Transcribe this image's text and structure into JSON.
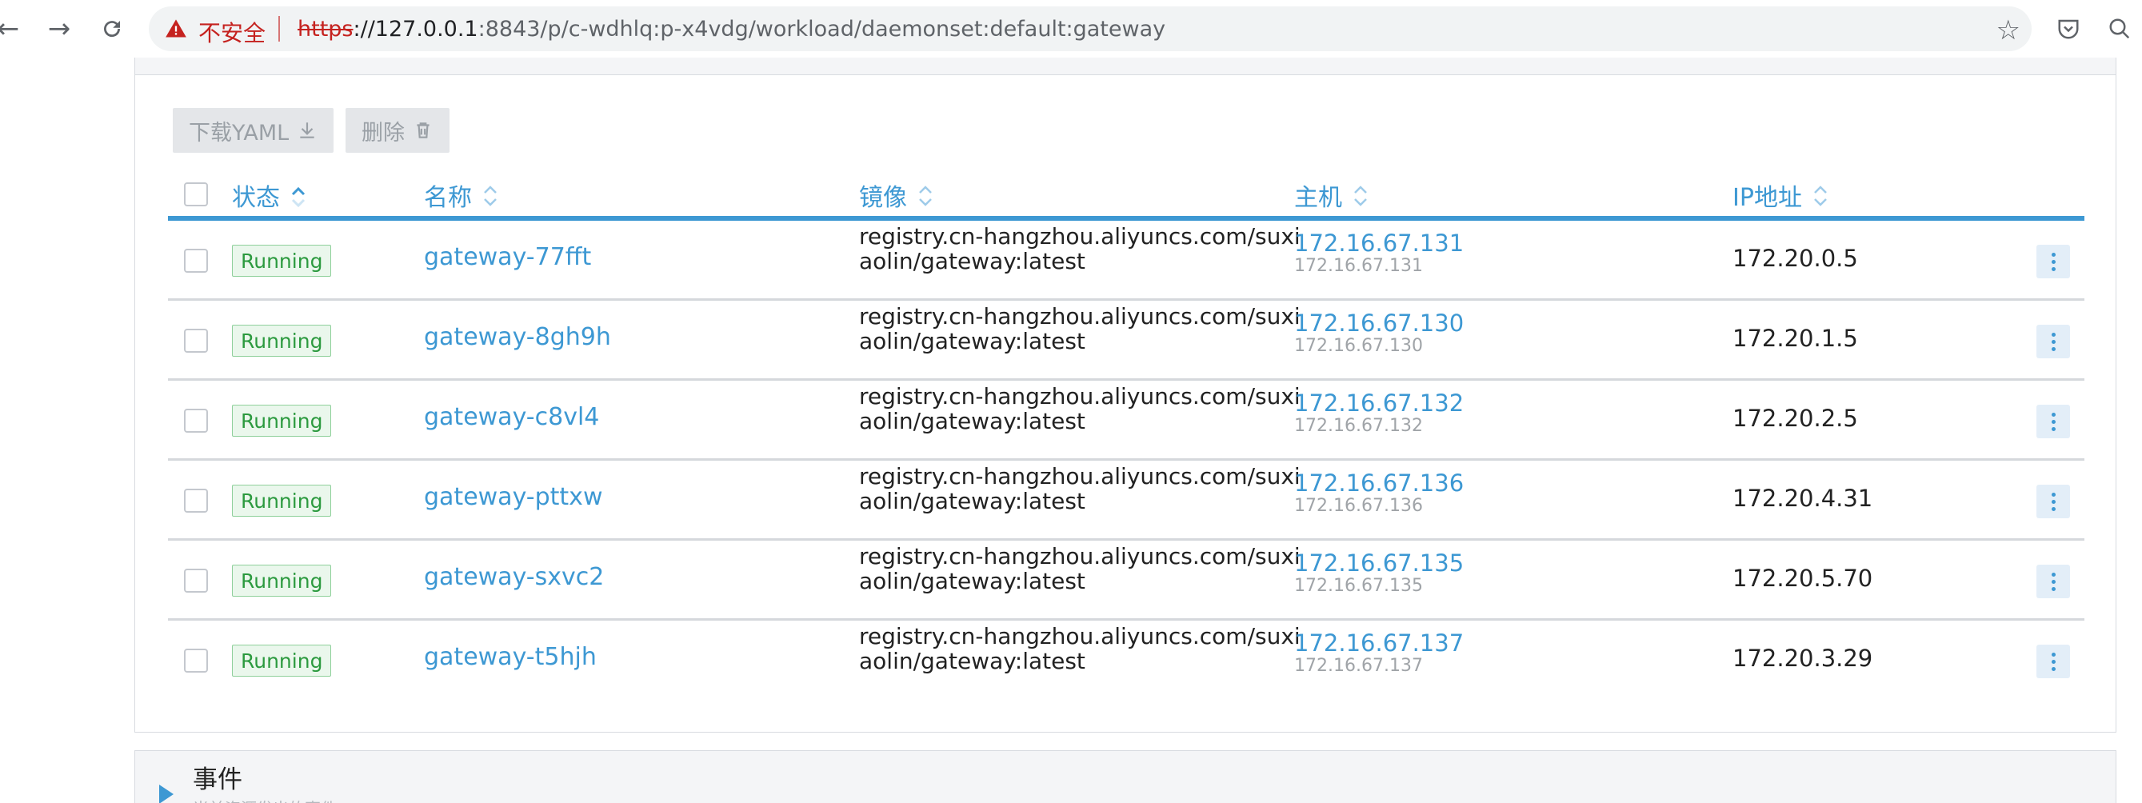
{
  "browser": {
    "insecure_label": "不安全",
    "url_scheme": "https",
    "url_host": "://127.0.0.1",
    "url_rest": ":8843/p/c-wdhlq:p-x4vdg/workload/daemonset:default:gateway"
  },
  "toolbar": {
    "download_label": "下载YAML",
    "delete_label": "删除"
  },
  "table": {
    "columns": {
      "state": "状态",
      "name": "名称",
      "image": "镜像",
      "node": "主机",
      "ip": "IP地址"
    },
    "rows": [
      {
        "state": "Running",
        "name": "gateway-77fft",
        "image": "registry.cn-hangzhou.aliyuncs.com/suxiaolin/gateway:latest",
        "node": "172.16.67.131",
        "node_sub": "172.16.67.131",
        "ip": "172.20.0.5"
      },
      {
        "state": "Running",
        "name": "gateway-8gh9h",
        "image": "registry.cn-hangzhou.aliyuncs.com/suxiaolin/gateway:latest",
        "node": "172.16.67.130",
        "node_sub": "172.16.67.130",
        "ip": "172.20.1.5"
      },
      {
        "state": "Running",
        "name": "gateway-c8vl4",
        "image": "registry.cn-hangzhou.aliyuncs.com/suxiaolin/gateway:latest",
        "node": "172.16.67.132",
        "node_sub": "172.16.67.132",
        "ip": "172.20.2.5"
      },
      {
        "state": "Running",
        "name": "gateway-pttxw",
        "image": "registry.cn-hangzhou.aliyuncs.com/suxiaolin/gateway:latest",
        "node": "172.16.67.136",
        "node_sub": "172.16.67.136",
        "ip": "172.20.4.31"
      },
      {
        "state": "Running",
        "name": "gateway-sxvc2",
        "image": "registry.cn-hangzhou.aliyuncs.com/suxiaolin/gateway:latest",
        "node": "172.16.67.135",
        "node_sub": "172.16.67.135",
        "ip": "172.20.5.70"
      },
      {
        "state": "Running",
        "name": "gateway-t5hjh",
        "image": "registry.cn-hangzhou.aliyuncs.com/suxiaolin/gateway:latest",
        "node": "172.16.67.137",
        "node_sub": "172.16.67.137",
        "ip": "172.20.3.29"
      }
    ]
  },
  "events": {
    "title": "事件",
    "subtitle": "当前资源发出的事件"
  },
  "colors": {
    "accent": "#3d98d3",
    "running": "#2c9a3f",
    "insecure": "#c5221f"
  }
}
